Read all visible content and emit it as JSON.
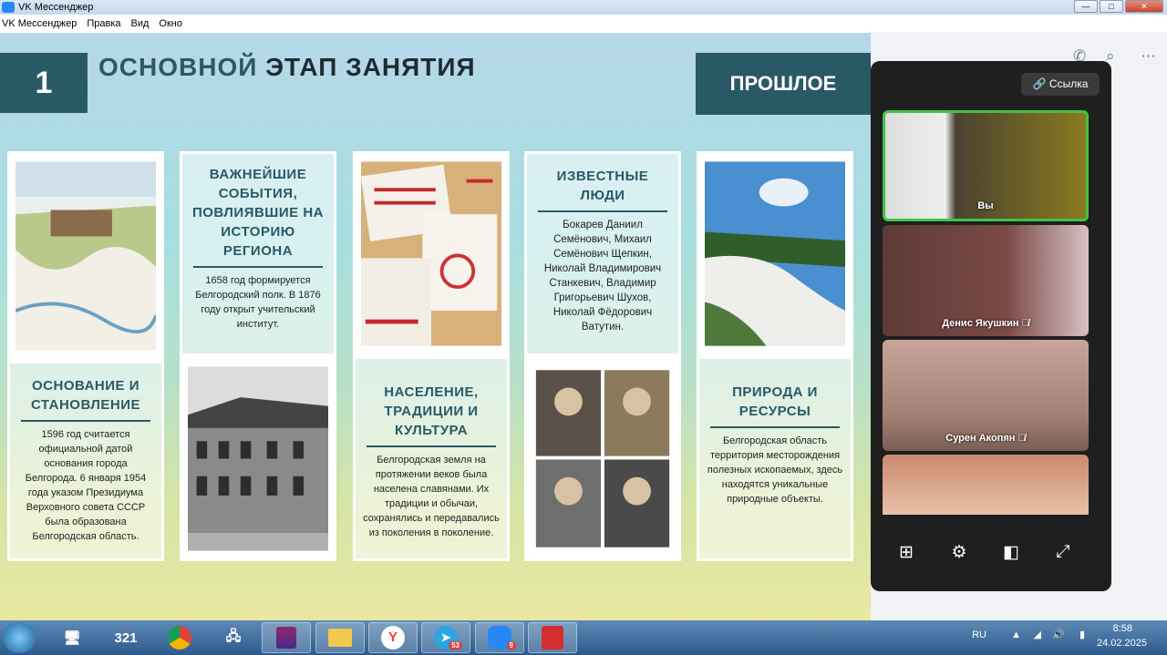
{
  "window": {
    "title": "VK Мессенджер",
    "controls": [
      "—",
      "□",
      "✕"
    ]
  },
  "menu": {
    "items": [
      "VK Мессенджер",
      "Правка",
      "Вид",
      "Окно"
    ]
  },
  "slide": {
    "number": "1",
    "title_part1": "ОСНОВНОЙ",
    "title_part2": "ЭТАП ЗАНЯТИЯ",
    "past_label": "ПРОШЛОЕ",
    "cards": {
      "foundation": {
        "heading": "ОСНОВАНИЕ И СТАНОВЛЕНИЕ",
        "text": "1596 год считается официальной датой основания города Белгорода. 6 января 1954 года указом Президиума Верховного совета СССР была образована Белгородская область."
      },
      "events": {
        "heading": "ВАЖНЕЙШИЕ СОБЫТИЯ, ПОВЛИЯВШИЕ НА ИСТОРИЮ РЕГИОНА",
        "text": "1658 год формируется Белгородский полк. В 1876 году открыт учительский институт."
      },
      "population": {
        "heading": "НАСЕЛЕНИЕ, ТРАДИЦИИ И КУЛЬТУРА",
        "text": "Белгородская земля на протяжении веков была населена славянами. Их традиции и обычаи, сохранялись и передавались из поколения в поколение."
      },
      "people": {
        "heading": "ИЗВЕСТНЫЕ ЛЮДИ",
        "text": "Бокарев Даниил Семёнович, Михаил Семёнович Щепкин, Николай Владимирович Станкевич, Владимир Григорьевич Шухов, Николай Фёдорович Ватутин."
      },
      "nature": {
        "heading": "ПРИРОДА И РЕСУРСЫ",
        "text": "Белгородская область территория месторождения полезных ископаемых, здесь находятся уникальные природные объекты."
      }
    }
  },
  "call": {
    "link_button": "Ссылка",
    "participants": [
      {
        "name": "Вы",
        "active": true
      },
      {
        "name": "Денис Якушкин",
        "muted": true
      },
      {
        "name": "Сурен Акопян",
        "muted": true
      },
      {
        "name": ""
      }
    ],
    "controls": [
      "grid-icon",
      "settings-icon",
      "layout-icon",
      "fullscreen-icon"
    ]
  },
  "taskbar": {
    "apps": [
      {
        "name": "monitor-icon",
        "label": ""
      },
      {
        "name": "media-player-icon",
        "label": "321"
      },
      {
        "name": "chrome-icon",
        "label": ""
      },
      {
        "name": "network-icon",
        "label": ""
      },
      {
        "name": "archive-icon",
        "label": ""
      },
      {
        "name": "folder-icon",
        "label": ""
      },
      {
        "name": "yandex-icon",
        "label": "Y"
      },
      {
        "name": "telegram-icon",
        "label": "",
        "badge": "53"
      },
      {
        "name": "vk-messenger-icon",
        "label": "",
        "badge": "9"
      },
      {
        "name": "pdf-icon",
        "label": ""
      }
    ],
    "language": "RU",
    "time": "8:58",
    "date": "24.02.2025"
  }
}
